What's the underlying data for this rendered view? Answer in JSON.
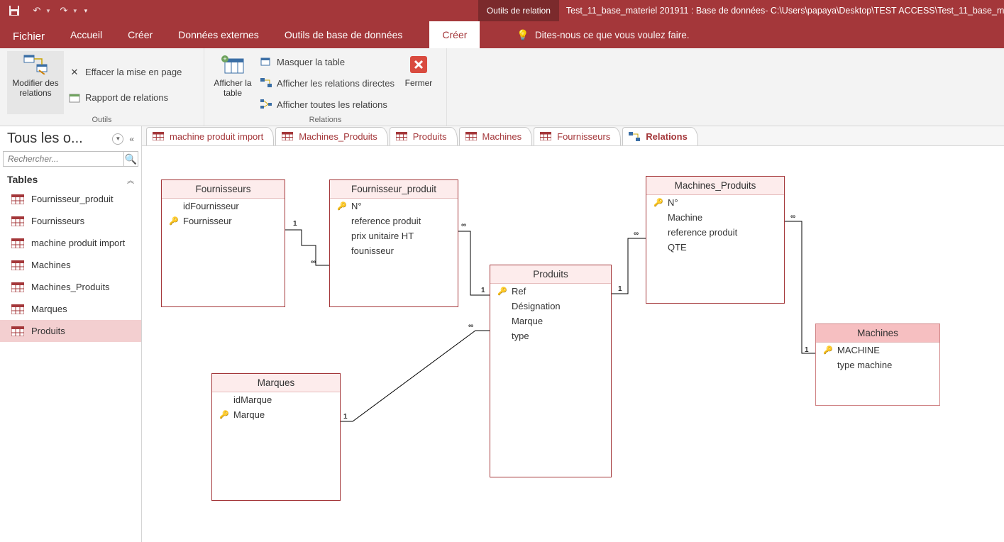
{
  "titlebar": {
    "context_tab": "Outils de relation",
    "title": "Test_11_base_materiel 201911 : Base de données- C:\\Users\\papaya\\Desktop\\TEST ACCESS\\Test_11_base_mate"
  },
  "tabs": {
    "file": "Fichier",
    "items": [
      "Accueil",
      "Créer",
      "Données externes",
      "Outils de base de données"
    ],
    "context_item": "Créer",
    "tell_me": "Dites-nous ce que vous voulez faire."
  },
  "ribbon": {
    "g1": {
      "big": "Modifier des relations",
      "label": "Outils",
      "r1": "Effacer la mise en page",
      "r2": "Rapport de relations"
    },
    "g2": {
      "big": "Afficher la table",
      "r1": "Masquer la table",
      "r2": "Afficher les relations directes",
      "r3": "Afficher toutes les relations",
      "label": "Relations"
    },
    "g3": {
      "big": "Fermer"
    }
  },
  "nav": {
    "title": "Tous les o...",
    "search_ph": "Rechercher...",
    "section": "Tables",
    "items": [
      "Fournisseur_produit",
      "Fournisseurs",
      "machine produit import",
      "Machines",
      "Machines_Produits",
      "Marques",
      "Produits"
    ],
    "selected_index": 6
  },
  "doctabs": [
    {
      "label": "machine produit import",
      "type": "table"
    },
    {
      "label": "Machines_Produits",
      "type": "table"
    },
    {
      "label": "Produits",
      "type": "table"
    },
    {
      "label": "Machines",
      "type": "table"
    },
    {
      "label": "Fournisseurs",
      "type": "table"
    },
    {
      "label": "Relations",
      "type": "rel",
      "active": true
    }
  ],
  "diagram": {
    "tables": {
      "fournisseurs": {
        "title": "Fournisseurs",
        "fields": [
          {
            "k": false,
            "n": "idFournisseur"
          },
          {
            "k": true,
            "n": "Fournisseur"
          }
        ]
      },
      "fournisseur_produit": {
        "title": "Fournisseur_produit",
        "fields": [
          {
            "k": true,
            "n": "N°"
          },
          {
            "k": false,
            "n": "reference produit"
          },
          {
            "k": false,
            "n": "prix unitaire HT"
          },
          {
            "k": false,
            "n": "founisseur"
          }
        ]
      },
      "produits": {
        "title": "Produits",
        "fields": [
          {
            "k": true,
            "n": "Ref"
          },
          {
            "k": false,
            "n": "Désignation"
          },
          {
            "k": false,
            "n": "Marque"
          },
          {
            "k": false,
            "n": "type"
          }
        ]
      },
      "machines_produits": {
        "title": "Machines_Produits",
        "fields": [
          {
            "k": true,
            "n": "N°"
          },
          {
            "k": false,
            "n": "Machine"
          },
          {
            "k": false,
            "n": "reference produit"
          },
          {
            "k": false,
            "n": "QTE"
          }
        ]
      },
      "marques": {
        "title": "Marques",
        "fields": [
          {
            "k": false,
            "n": "idMarque"
          },
          {
            "k": true,
            "n": "Marque"
          }
        ]
      },
      "machines": {
        "title": "Machines",
        "fields": [
          {
            "k": true,
            "n": "MACHINE"
          },
          {
            "k": false,
            "n": "type machine"
          }
        ]
      }
    }
  }
}
